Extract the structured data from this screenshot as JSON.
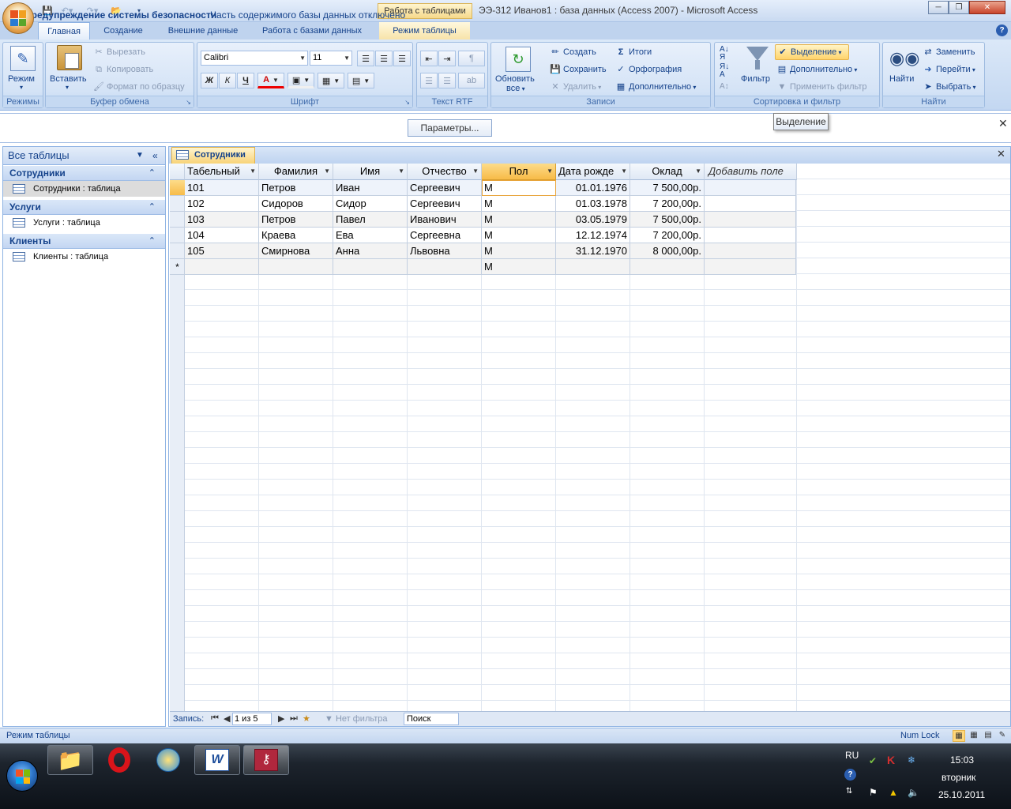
{
  "window": {
    "context_tab": "Работа с таблицами",
    "title": "ЭЭ-312 Иванов1 : база данных (Access 2007) - Microsoft Access"
  },
  "ribbon_tabs": [
    "Главная",
    "Создание",
    "Внешние данные",
    "Работа с базами данных",
    "Режим таблицы"
  ],
  "groups": {
    "views": {
      "label": "Режимы",
      "mode_button": "Режим"
    },
    "clipboard": {
      "label": "Буфер обмена",
      "paste": "Вставить",
      "cut": "Вырезать",
      "copy": "Копировать",
      "format_painter": "Формат по образцу"
    },
    "font": {
      "label": "Шрифт",
      "font_name": "Calibri",
      "font_size": "11",
      "bold": "Ж",
      "italic": "К",
      "underline": "Ч",
      "font_color": "A"
    },
    "rtf": {
      "label": "Текст RTF"
    },
    "records": {
      "label": "Записи",
      "refresh": "Обновить",
      "refresh_sub": "все",
      "new": "Создать",
      "save": "Сохранить",
      "delete": "Удалить",
      "totals": "Итоги",
      "spelling": "Орфография",
      "more": "Дополнительно"
    },
    "sort_filter": {
      "label": "Сортировка и фильтр",
      "filter": "Фильтр",
      "selection": "Выделение",
      "advanced": "Дополнительно",
      "toggle_filter": "Применить фильтр"
    },
    "find": {
      "label": "Найти",
      "find": "Найти",
      "replace": "Заменить",
      "goto": "Перейти",
      "select": "Выбрать"
    }
  },
  "tooltip": "Выделение",
  "security": {
    "title": "Предупреждение системы безопасности",
    "message": "Часть содержимого базы данных отключено",
    "button": "Параметры..."
  },
  "nav_pane": {
    "header": "Все таблицы",
    "groups": [
      {
        "name": "Сотрудники",
        "item": "Сотрудники : таблица"
      },
      {
        "name": "Услуги",
        "item": "Услуги : таблица"
      },
      {
        "name": "Клиенты",
        "item": "Клиенты : таблица"
      }
    ]
  },
  "document_tab": "Сотрудники",
  "table": {
    "columns": [
      "Табельный",
      "Фамилия",
      "Имя",
      "Отчество",
      "Пол",
      "Дата рожде",
      "Оклад",
      "Добавить поле"
    ],
    "rows": [
      [
        "101",
        "Петров",
        "Иван",
        "Сергеевич",
        "М",
        "01.01.1976",
        "7 500,00р."
      ],
      [
        "102",
        "Сидоров",
        "Сидор",
        "Сергеевич",
        "М",
        "01.03.1978",
        "7 200,00р."
      ],
      [
        "103",
        "Петров",
        "Павел",
        "Иванович",
        "М",
        "03.05.1979",
        "7 500,00р."
      ],
      [
        "104",
        "Краева",
        "Ева",
        "Сергеевна",
        "М",
        "12.12.1974",
        "7 200,00р."
      ],
      [
        "105",
        "Смирнова",
        "Анна",
        "Львовна",
        "М",
        "31.12.1970",
        "8 000,00р."
      ]
    ],
    "new_row_marker": "*",
    "new_row_default": "М"
  },
  "record_nav": {
    "label": "Запись:",
    "position": "1 из 5",
    "filter": "Нет фильтра",
    "search": "Поиск"
  },
  "status": {
    "left": "Режим таблицы",
    "num_lock": "Num Lock"
  },
  "taskbar": {
    "lang": "RU",
    "time": "15:03",
    "weekday": "вторник",
    "date": "25.10.2011"
  }
}
